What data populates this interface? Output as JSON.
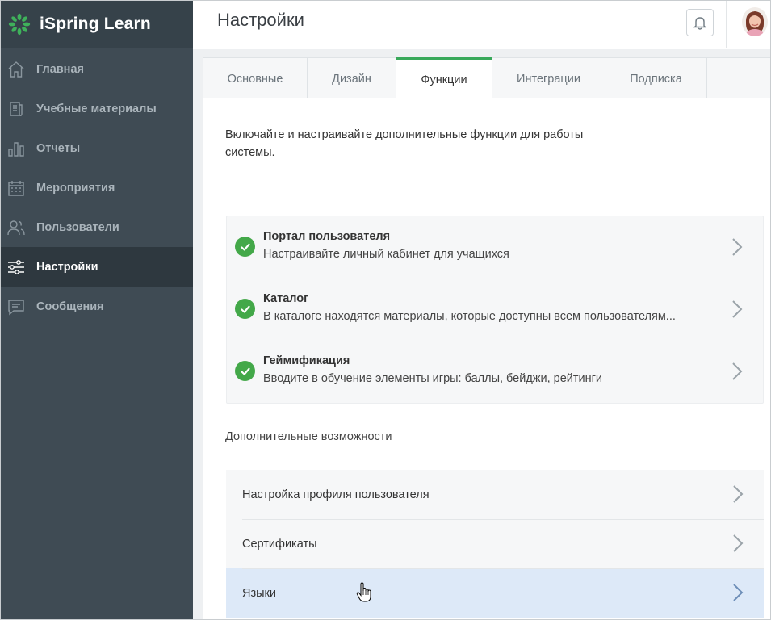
{
  "brand": {
    "name": "iSpring Learn",
    "accent": "#3fb15b"
  },
  "sidebar": {
    "items": [
      {
        "label": "Главная",
        "icon": "home-icon"
      },
      {
        "label": "Учебные материалы",
        "icon": "document-icon"
      },
      {
        "label": "Отчеты",
        "icon": "bar-chart-icon"
      },
      {
        "label": "Мероприятия",
        "icon": "calendar-icon"
      },
      {
        "label": "Пользователи",
        "icon": "users-icon"
      },
      {
        "label": "Настройки",
        "icon": "sliders-icon",
        "active": true
      },
      {
        "label": "Сообщения",
        "icon": "message-icon"
      }
    ]
  },
  "header": {
    "title": "Настройки",
    "bell_icon": "bell-icon",
    "avatar_icon": "user-avatar"
  },
  "tabs": [
    {
      "label": "Основные"
    },
    {
      "label": "Дизайн"
    },
    {
      "label": "Функции",
      "active": true
    },
    {
      "label": "Интеграции"
    },
    {
      "label": "Подписка"
    }
  ],
  "main": {
    "intro": "Включайте и настраивайте дополнительные функции для работы системы.",
    "features": [
      {
        "title": "Портал пользователя",
        "desc": "Настраивайте личный кабинет для учащихся"
      },
      {
        "title": "Каталог",
        "desc": "В каталоге находятся материалы, которые доступны всем пользователям..."
      },
      {
        "title": "Геймификация",
        "desc": "Вводите в обучение элементы игры: баллы, бейджи, рейтинги"
      }
    ],
    "extra_title": "Дополнительные возможности",
    "extras": [
      {
        "label": "Настройка профиля пользователя"
      },
      {
        "label": "Сертификаты"
      },
      {
        "label": "Языки"
      }
    ]
  },
  "colors": {
    "sidebar_bg": "#3f4b54",
    "sidebar_active_bg": "#2e383f",
    "check_green": "#43a849",
    "tab_accent": "#38a85a",
    "row_highlight": "#dde9f8"
  }
}
